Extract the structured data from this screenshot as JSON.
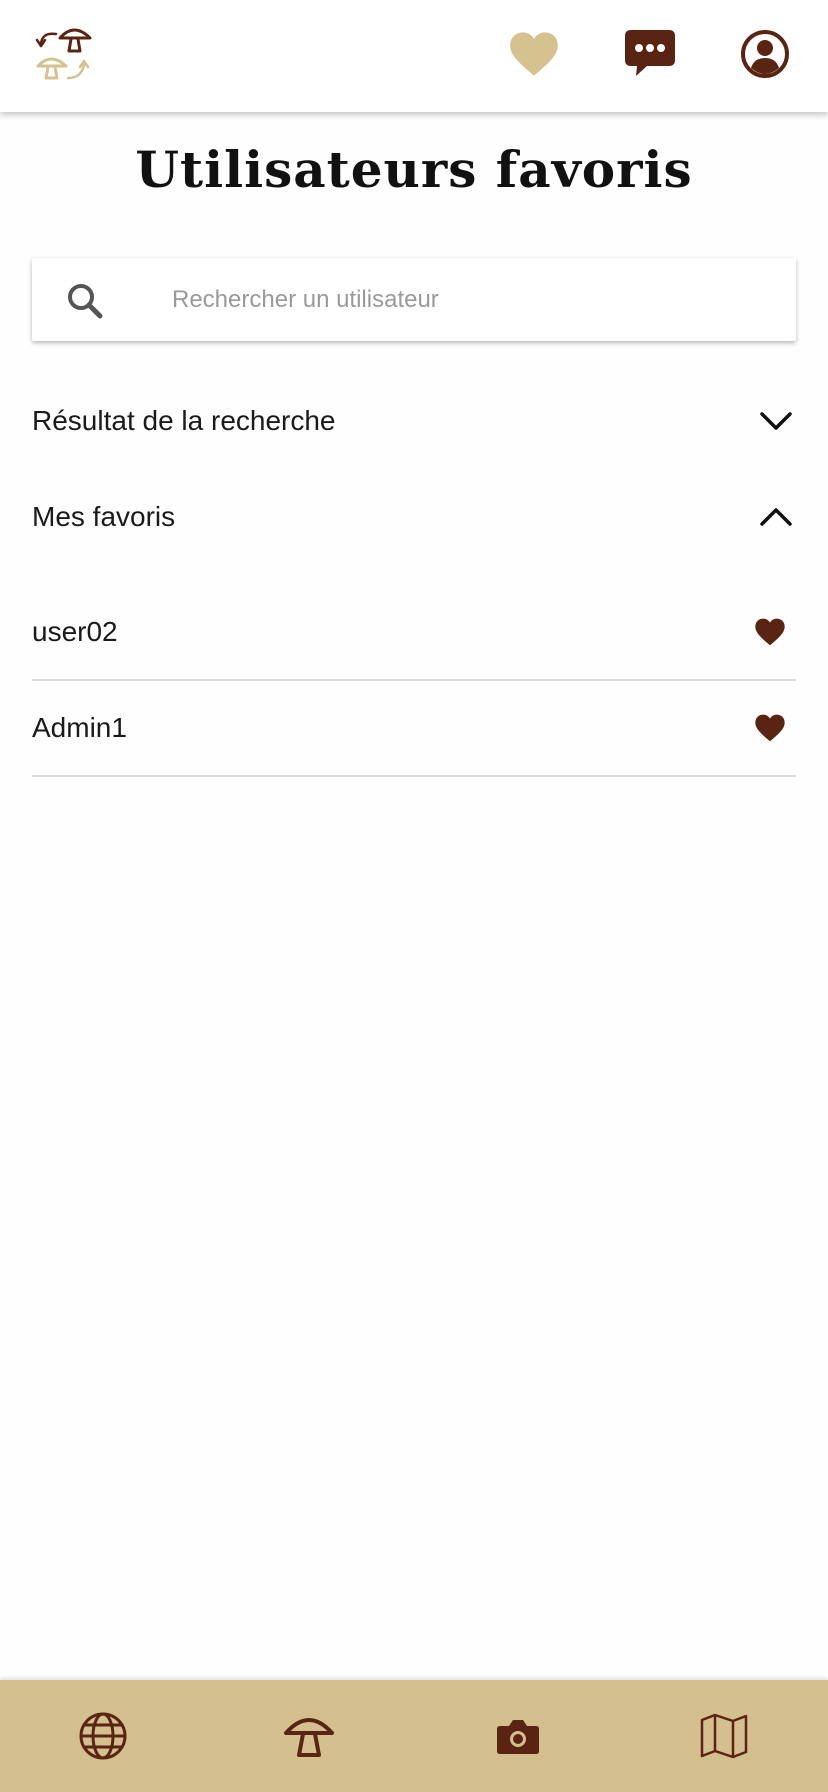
{
  "header": {
    "logo_icon": "mushroom-exchange-logo",
    "favorites_icon": "heart-icon",
    "messages_icon": "chat-bubble-icon",
    "profile_icon": "user-circle-icon"
  },
  "colors": {
    "brown": "#5a2412",
    "sand": "#d4c08e",
    "light_sand": "#d6c28f"
  },
  "page": {
    "title": "Utilisateurs favoris"
  },
  "search": {
    "placeholder": "Rechercher un utilisateur",
    "value": ""
  },
  "sections": {
    "results": {
      "label": "Résultat de la recherche",
      "expanded": false
    },
    "favorites": {
      "label": "Mes favoris",
      "expanded": true
    }
  },
  "favorites": [
    {
      "name": "user02"
    },
    {
      "name": "Admin1"
    }
  ],
  "bottom_nav": [
    {
      "icon": "globe-icon"
    },
    {
      "icon": "mushroom-icon"
    },
    {
      "icon": "camera-icon"
    },
    {
      "icon": "map-icon"
    }
  ]
}
